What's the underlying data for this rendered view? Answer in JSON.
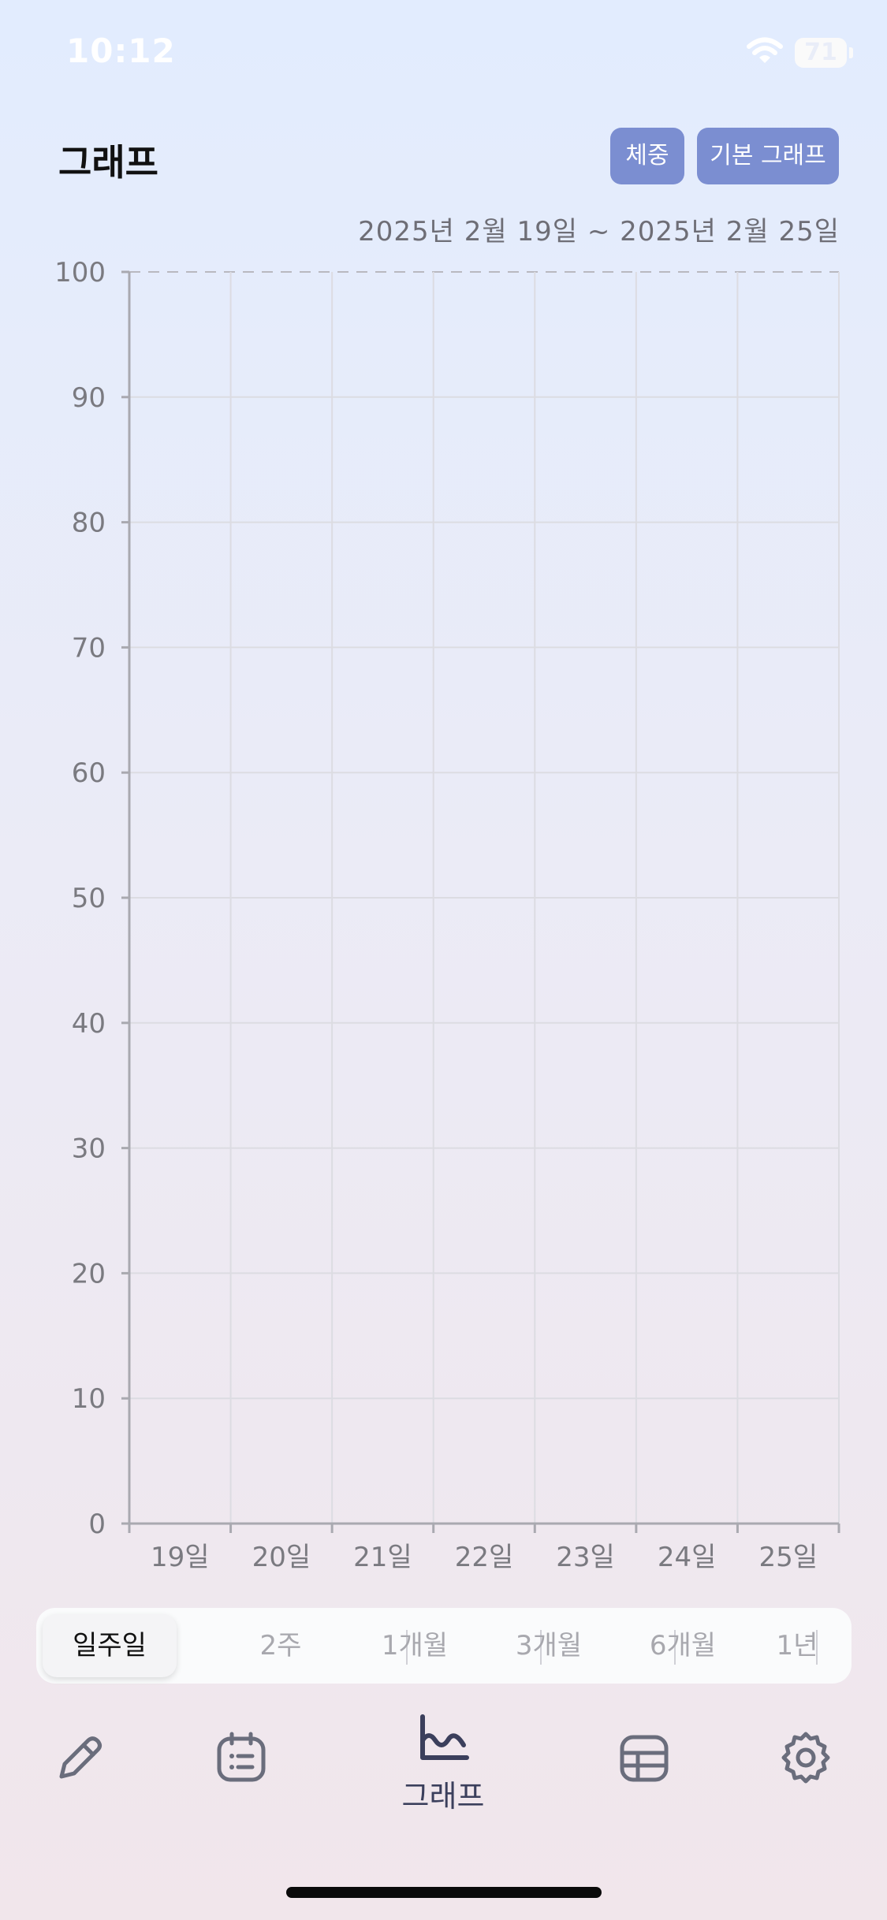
{
  "status_bar": {
    "time": "10:12",
    "battery": "71"
  },
  "header": {
    "title": "그래프",
    "weight_button": "체중",
    "graph_button": "기본 그래프",
    "date_range": "2025년 2월 19일 ~ 2025년 2월 25일"
  },
  "chart_data": {
    "type": "line",
    "categories": [
      "19일",
      "20일",
      "21일",
      "22일",
      "23일",
      "24일",
      "25일"
    ],
    "series": [],
    "ylim": [
      0,
      100
    ],
    "yticks": [
      0,
      10,
      20,
      30,
      40,
      50,
      60,
      70,
      80,
      90,
      100
    ],
    "grid": true
  },
  "period_selector": {
    "options": [
      "일주일",
      "2주",
      "1개월",
      "3개월",
      "6개월",
      "1년"
    ],
    "selected": "일주일"
  },
  "tab_bar": {
    "items": [
      {
        "icon": "pencil-icon",
        "label": ""
      },
      {
        "icon": "calendar-list-icon",
        "label": ""
      },
      {
        "icon": "graph-icon",
        "label": "그래프"
      },
      {
        "icon": "table-icon",
        "label": ""
      },
      {
        "icon": "gear-icon",
        "label": ""
      }
    ],
    "active_index": 2
  }
}
